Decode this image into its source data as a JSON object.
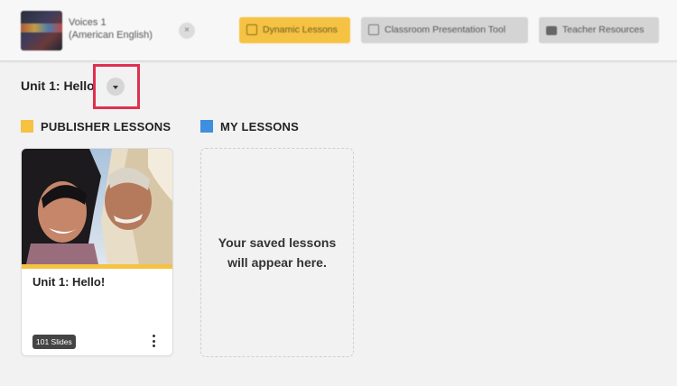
{
  "header": {
    "book_title_line1": "Voices 1",
    "book_title_line2": "(American English)",
    "close_glyph": "×",
    "nav": [
      {
        "label": "Dynamic Lessons",
        "icon": "lesson-icon",
        "active": true
      },
      {
        "label": "Classroom Presentation Tool",
        "icon": "presentation-icon",
        "active": false
      },
      {
        "label": "Teacher Resources",
        "icon": "briefcase-icon",
        "active": false
      }
    ]
  },
  "unit_selector": {
    "label": "Unit 1: Hello"
  },
  "sections": {
    "publisher": {
      "label": "PUBLISHER LESSONS",
      "color": "#f5c243"
    },
    "mine": {
      "label": "MY LESSONS",
      "color": "#3f8fe0"
    }
  },
  "publisher_lessons": [
    {
      "title": "Unit 1: Hello!",
      "slides": "101 Slides"
    }
  ],
  "my_lessons_empty": {
    "line1": "Your saved lessons",
    "line2": "will appear here."
  },
  "colors": {
    "accent": "#f5c243",
    "highlight": "#e0304f"
  }
}
